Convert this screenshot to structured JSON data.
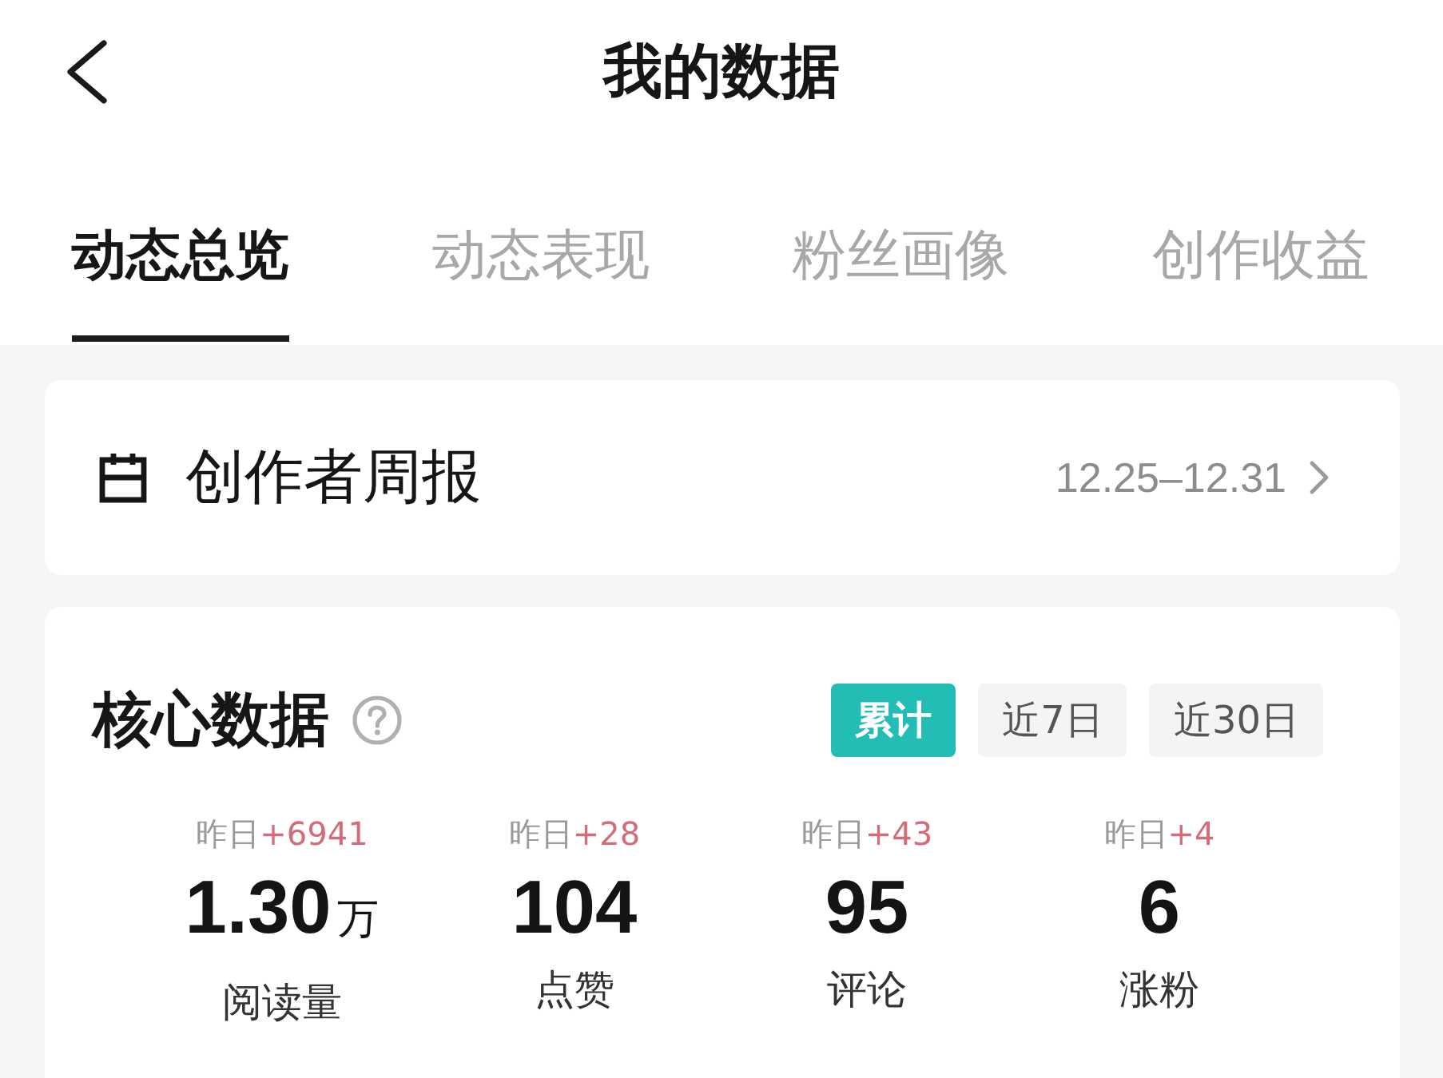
{
  "header": {
    "title": "我的数据"
  },
  "tabs": [
    {
      "label": "动态总览",
      "selected": true
    },
    {
      "label": "动态表现",
      "selected": false
    },
    {
      "label": "粉丝画像",
      "selected": false
    },
    {
      "label": "创作收益",
      "selected": false
    }
  ],
  "weekly_report": {
    "title": "创作者周报",
    "date_range": "12.25–12.31"
  },
  "core_data": {
    "title": "核心数据",
    "periods": [
      {
        "label": "累计",
        "selected": true
      },
      {
        "label": "近7日",
        "selected": false
      },
      {
        "label": "近30日",
        "selected": false
      }
    ],
    "stats": [
      {
        "yesterday_label": "昨日",
        "change": "+6941",
        "value": "1.30",
        "unit": "万",
        "label": "阅读量"
      },
      {
        "yesterday_label": "昨日",
        "change": "+28",
        "value": "104",
        "label": "点赞"
      },
      {
        "yesterday_label": "昨日",
        "change": "+43",
        "value": "95",
        "label": "评论"
      },
      {
        "yesterday_label": "昨日",
        "change": "+4",
        "value": "6",
        "label": "涨粉"
      }
    ]
  }
}
